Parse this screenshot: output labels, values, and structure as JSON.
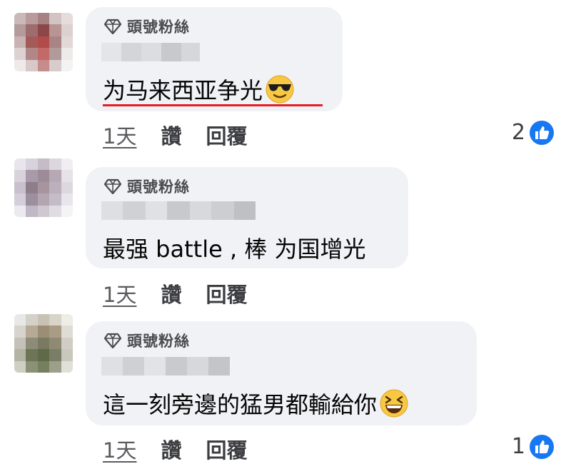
{
  "comments": [
    {
      "badge": "頭號粉絲",
      "text": "为马来西亚争光",
      "emoji": "sunglasses-face",
      "time": "1天",
      "like_label": "讚",
      "reply_label": "回覆",
      "reaction_count": "2"
    },
    {
      "badge": "頭號粉絲",
      "text": "最强 battle , 棒 为国增光",
      "time": "1天",
      "like_label": "讚",
      "reply_label": "回覆"
    },
    {
      "badge": "頭號粉絲",
      "text": "這一刻旁邊的猛男都輸給你",
      "emoji": "grinning-squinting-face",
      "time": "1天",
      "like_label": "讚",
      "reply_label": "回覆",
      "reaction_count": "1"
    }
  ],
  "colors": {
    "bubble": "#f0f2f5",
    "like_blue": "#1877f2",
    "underline_red": "#e41e26"
  }
}
